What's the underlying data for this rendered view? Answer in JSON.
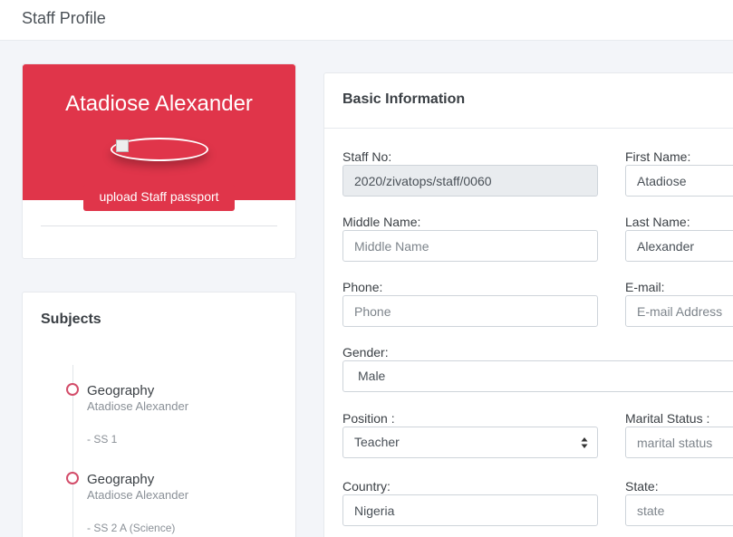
{
  "header": {
    "title": "Staff Profile"
  },
  "profile": {
    "name": "Atadiose Alexander",
    "upload_label": "upload Staff passport"
  },
  "subjects": {
    "title": "Subjects",
    "items": [
      {
        "subject": "Geography",
        "teacher": "Atadiose Alexander",
        "class": "- SS 1"
      },
      {
        "subject": "Geography",
        "teacher": "Atadiose Alexander",
        "class": "- SS 2 A (Science)"
      }
    ]
  },
  "basic_info": {
    "title": "Basic Information",
    "staff_no": {
      "label": "Staff No:",
      "value": "2020/zivatops/staff/0060"
    },
    "first_name": {
      "label": "First Name:",
      "value": "Atadiose"
    },
    "middle_name": {
      "label": "Middle Name:",
      "placeholder": "Middle Name"
    },
    "last_name": {
      "label": "Last Name:",
      "value": "Alexander"
    },
    "phone": {
      "label": "Phone:",
      "placeholder": "Phone"
    },
    "email": {
      "label": "E-mail:",
      "placeholder": "E-mail Address"
    },
    "gender": {
      "label": "Gender:",
      "value": "Male"
    },
    "position": {
      "label": "Position :",
      "value": "Teacher"
    },
    "marital_status": {
      "label": "Marital Status :",
      "placeholder": "marital status"
    },
    "country": {
      "label": "Country:",
      "value": "Nigeria"
    },
    "state": {
      "label": "State:",
      "placeholder": "state"
    }
  },
  "colors": {
    "accent": "#e0354a",
    "timeline_dot": "#d34d6a"
  }
}
